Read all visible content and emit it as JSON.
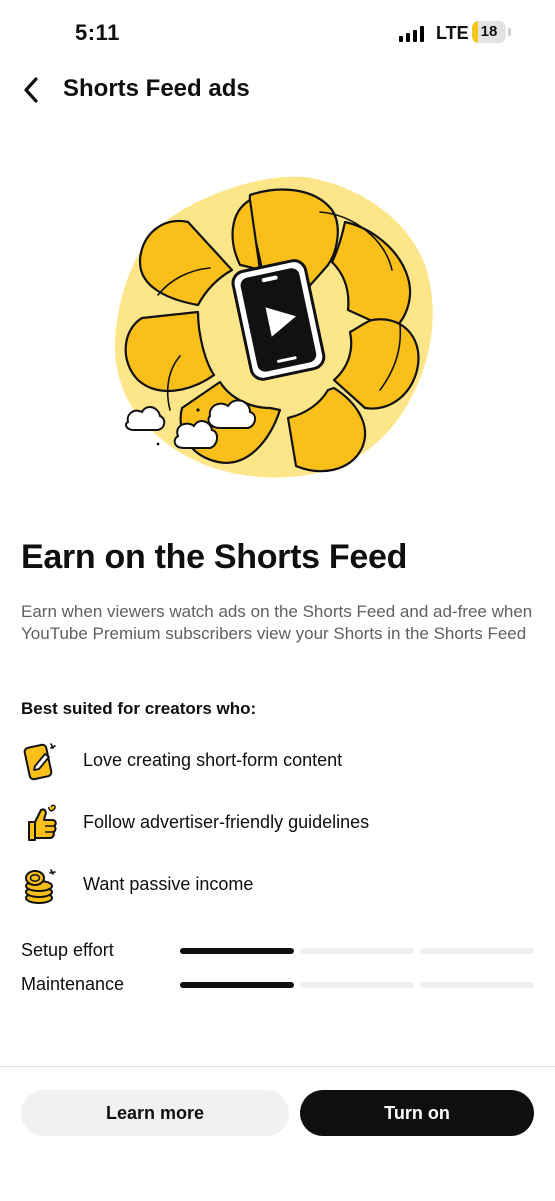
{
  "status_bar": {
    "time": "5:11",
    "network": "LTE",
    "battery": "18"
  },
  "header": {
    "title": "Shorts Feed ads",
    "back_icon": "chevron-left-icon"
  },
  "hero": {
    "illustration": "shorts-phone-petals-illustration",
    "colors": {
      "light": "#fde68a",
      "main": "#fbbf1a",
      "outline": "#111111"
    }
  },
  "main": {
    "headline": "Earn on the Shorts Feed",
    "description": "Earn when viewers watch ads on the Shorts Feed and ad-free when YouTube Premium subscribers view your Shorts in the Shorts Feed",
    "suited_heading": "Best suited for creators who:",
    "features": [
      {
        "icon": "phone-pencil-icon",
        "label": "Love creating short-form content"
      },
      {
        "icon": "thumbs-up-icon",
        "label": "Follow advertiser-friendly guidelines"
      },
      {
        "icon": "coins-icon",
        "label": "Want passive income"
      }
    ],
    "effort": [
      {
        "label": "Setup effort",
        "level": 1,
        "max": 3
      },
      {
        "label": "Maintenance",
        "level": 1,
        "max": 3
      }
    ]
  },
  "footer": {
    "learn_more_label": "Learn more",
    "turn_on_label": "Turn on"
  },
  "colors": {
    "accent": "#fbbf1a",
    "primary_button": "#0f0f0f",
    "secondary_button": "#f1f1f1",
    "secondary_text": "#606060"
  }
}
